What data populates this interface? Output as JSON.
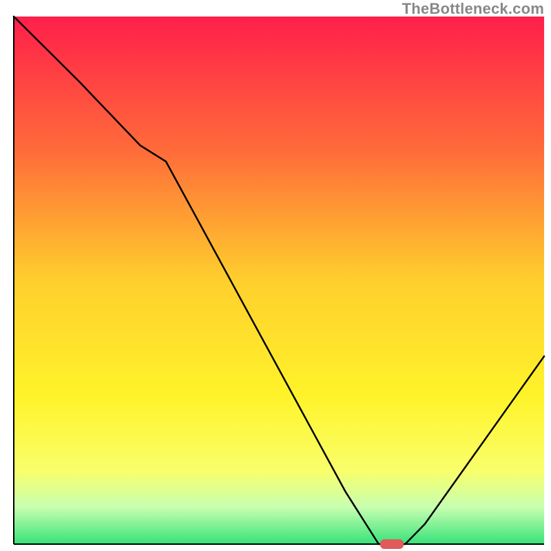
{
  "watermark_text": "TheBottleneck.com",
  "chart_data": {
    "type": "line",
    "title": "",
    "xlabel": "",
    "ylabel": "",
    "xlim": [
      0,
      100
    ],
    "ylim": [
      0,
      100
    ],
    "grid": false,
    "legend": false,
    "background_gradient": [
      {
        "pos": 0.0,
        "color": "#ff1f4a"
      },
      {
        "pos": 0.25,
        "color": "#ff6a3a"
      },
      {
        "pos": 0.5,
        "color": "#ffcf2d"
      },
      {
        "pos": 0.72,
        "color": "#fff32a"
      },
      {
        "pos": 0.86,
        "color": "#f9ff6a"
      },
      {
        "pos": 0.93,
        "color": "#c8ffb0"
      },
      {
        "pos": 1.0,
        "color": "#38e27a"
      }
    ],
    "series": [
      {
        "name": "bottleneck-curve",
        "x": [
          0.0,
          12.5,
          23.8,
          28.7,
          62.5,
          68.8,
          73.8,
          77.5,
          100.0
        ],
        "values": [
          100.0,
          87.5,
          75.6,
          72.5,
          10.0,
          0.0,
          0.0,
          3.8,
          35.6
        ]
      }
    ],
    "marker": {
      "name": "optimal-marker",
      "x": 71.3,
      "y": 0.0,
      "color": "#e05a5a"
    },
    "axes": {
      "left_border": true,
      "bottom_border": true,
      "border_color": "#000000",
      "border_width": 2
    }
  }
}
